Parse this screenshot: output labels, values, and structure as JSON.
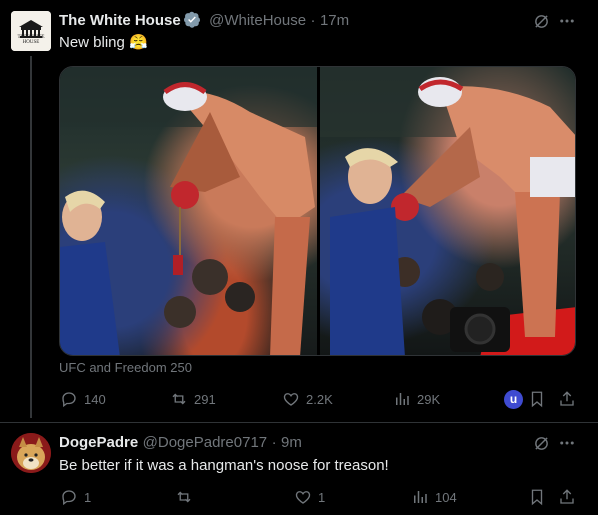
{
  "tweet1": {
    "author_name": "The White House",
    "handle": "@WhiteHouse",
    "dot": "·",
    "time": "17m",
    "text": "New bling",
    "emoji": "😤",
    "avatar_lines": [
      "THE",
      "WHITE",
      "HOUSE"
    ],
    "caption": "UFC and Freedom 250",
    "replies": "140",
    "reposts": "291",
    "likes": "2.2K",
    "views": "29K",
    "badge_letter": "u"
  },
  "tweet2": {
    "author_name": "DogePadre",
    "handle": "@DogePadre0717",
    "dot": "·",
    "time": "9m",
    "text": "Be better if it was a hangman's noose for treason!",
    "replies": "1",
    "reposts": "",
    "likes": "1",
    "views": "104"
  },
  "colors": {
    "background": "#000000",
    "text": "#e7e9ea",
    "muted": "#71767b",
    "verified_gray": "#829aab",
    "accent_badge": "#3f4bd1",
    "mat_red": "#d21a1a"
  },
  "icons": [
    "verified-icon",
    "grok-icon",
    "more-icon",
    "reply-icon",
    "repost-icon",
    "like-icon",
    "views-icon",
    "bookmark-icon",
    "share-icon"
  ]
}
